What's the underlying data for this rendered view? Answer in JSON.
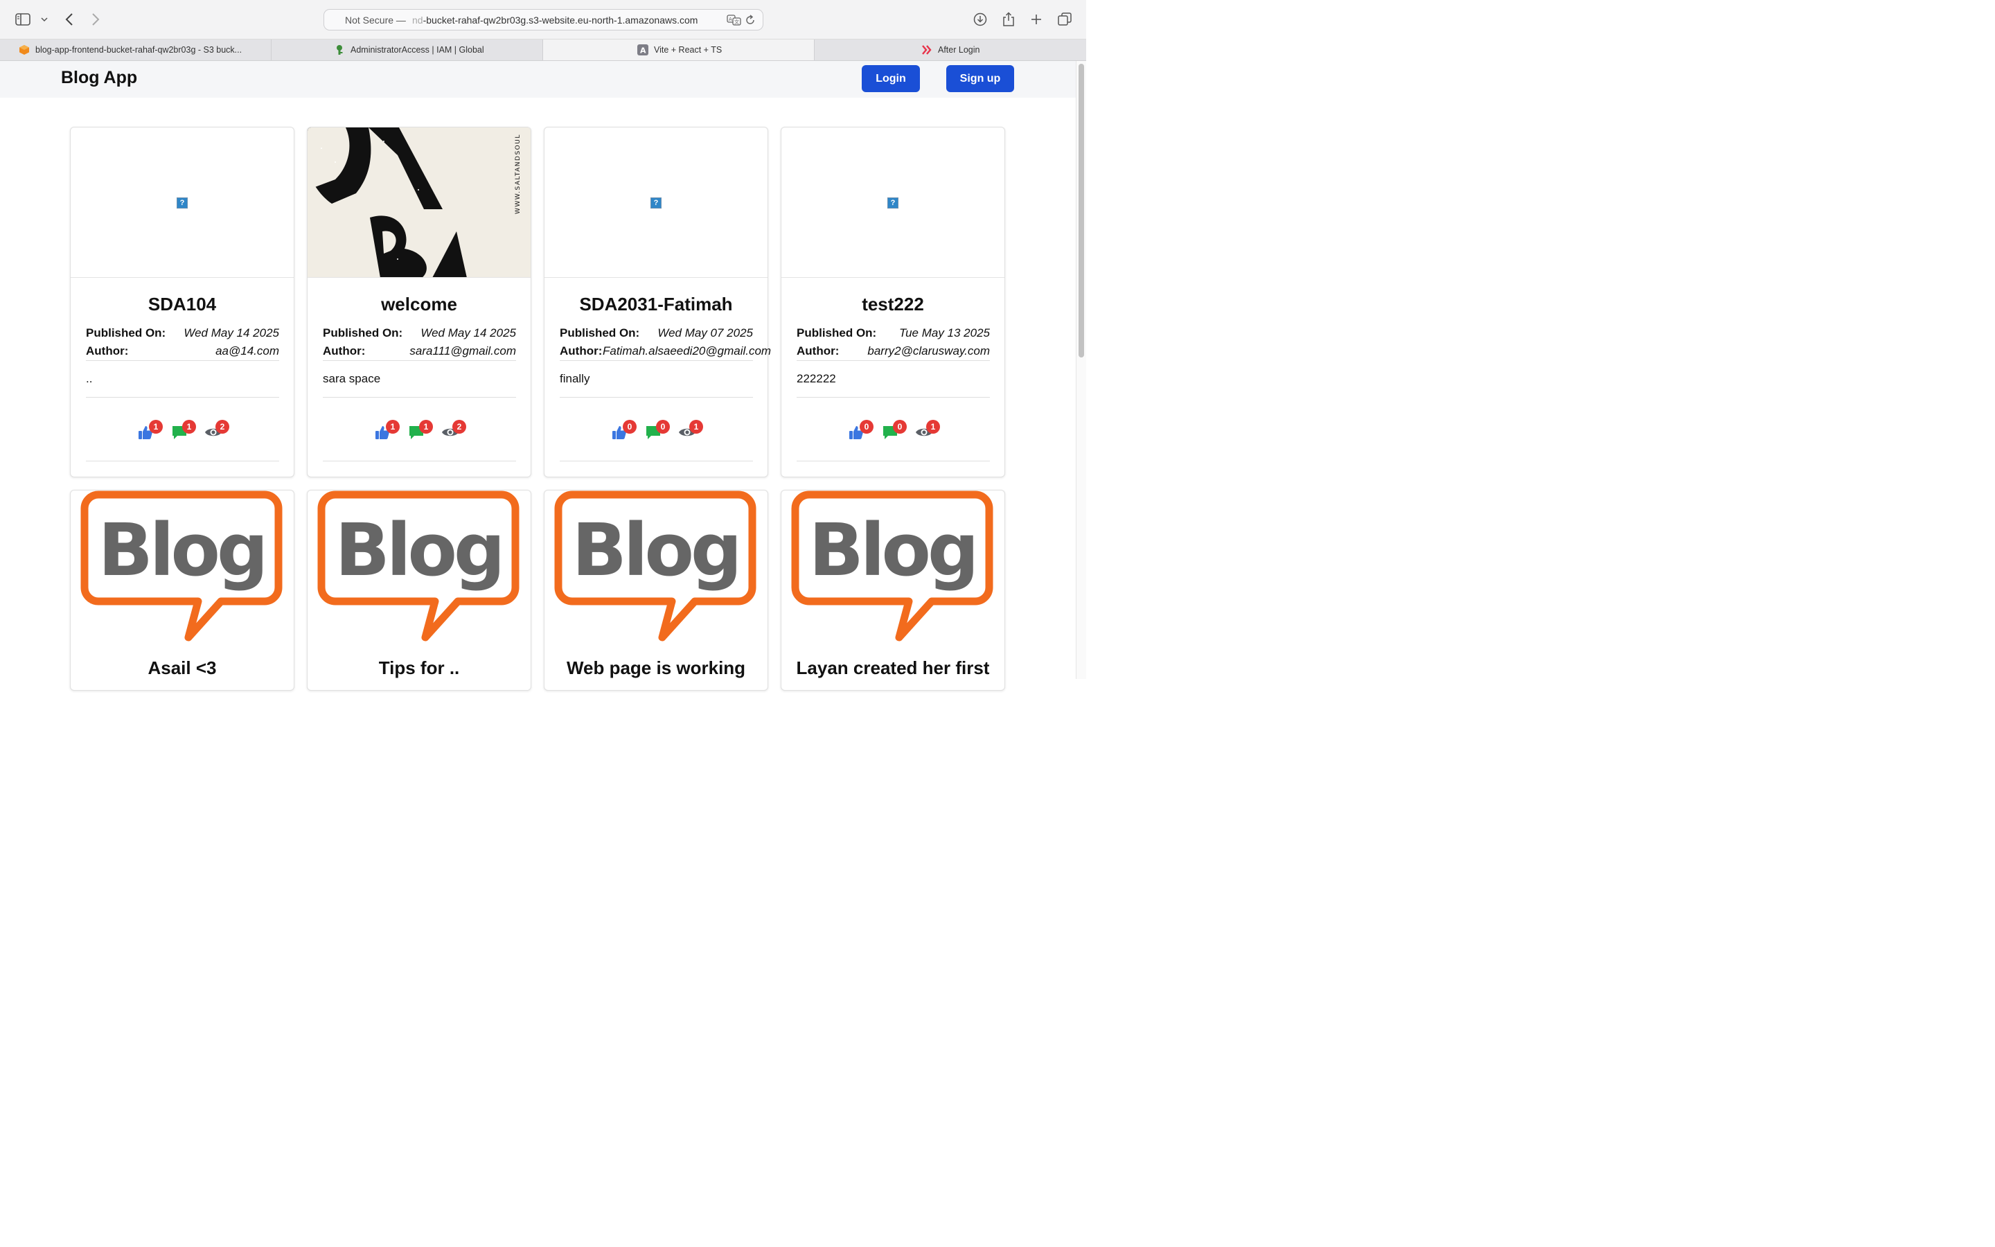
{
  "browser": {
    "url_security": "Not Secure —",
    "url_host_prefix": "nd",
    "url_host": "-bucket-rahaf-qw2br03g.s3-website.eu-north-1.amazonaws.com",
    "tabs": [
      {
        "label": "blog-app-frontend-bucket-rahaf-qw2br03g - S3 buck...",
        "icon": "aws-s3-icon",
        "active": false
      },
      {
        "label": "AdministratorAccess | IAM | Global",
        "icon": "iam-icon",
        "active": false
      },
      {
        "label": "Vite + React + TS",
        "icon": "vite-icon",
        "active": true
      },
      {
        "label": "After Login",
        "icon": "after-login-icon",
        "active": false
      }
    ]
  },
  "app": {
    "brand": "Blog App",
    "login_label": "Login",
    "signup_label": "Sign up",
    "accent": "#1a4fd6"
  },
  "labels": {
    "published_on": "Published On:",
    "author": "Author:"
  },
  "posts": [
    {
      "title": "SDA104",
      "published": "Wed May 14 2025",
      "author": "aa@14.com",
      "content": "..",
      "likes": "1",
      "comments": "1",
      "views": "2",
      "image": "broken"
    },
    {
      "title": "welcome",
      "published": "Wed May 14 2025",
      "author": "sara111@gmail.com",
      "content": "sara space",
      "likes": "1",
      "comments": "1",
      "views": "2",
      "image": "salt-and-soul",
      "image_text": "WWW.SALTANDSOUL"
    },
    {
      "title": "SDA2031-Fatimah",
      "published": "Wed May 07 2025",
      "author": "Fatimah.alsaeedi20@gmail.com",
      "content": "finally",
      "likes": "0",
      "comments": "0",
      "views": "1",
      "image": "broken"
    },
    {
      "title": "test222",
      "published": "Tue May 13 2025",
      "author": "barry2@clarusway.com",
      "content": "222222",
      "likes": "0",
      "comments": "0",
      "views": "1",
      "image": "broken"
    }
  ],
  "blog_posts": [
    {
      "title": "Asail <3",
      "logo_text": "Blog"
    },
    {
      "title": "Tips for ..",
      "logo_text": "Blog"
    },
    {
      "title": "Web page is working",
      "logo_text": "Blog"
    },
    {
      "title": "Layan created her first",
      "logo_text": "Blog"
    }
  ]
}
